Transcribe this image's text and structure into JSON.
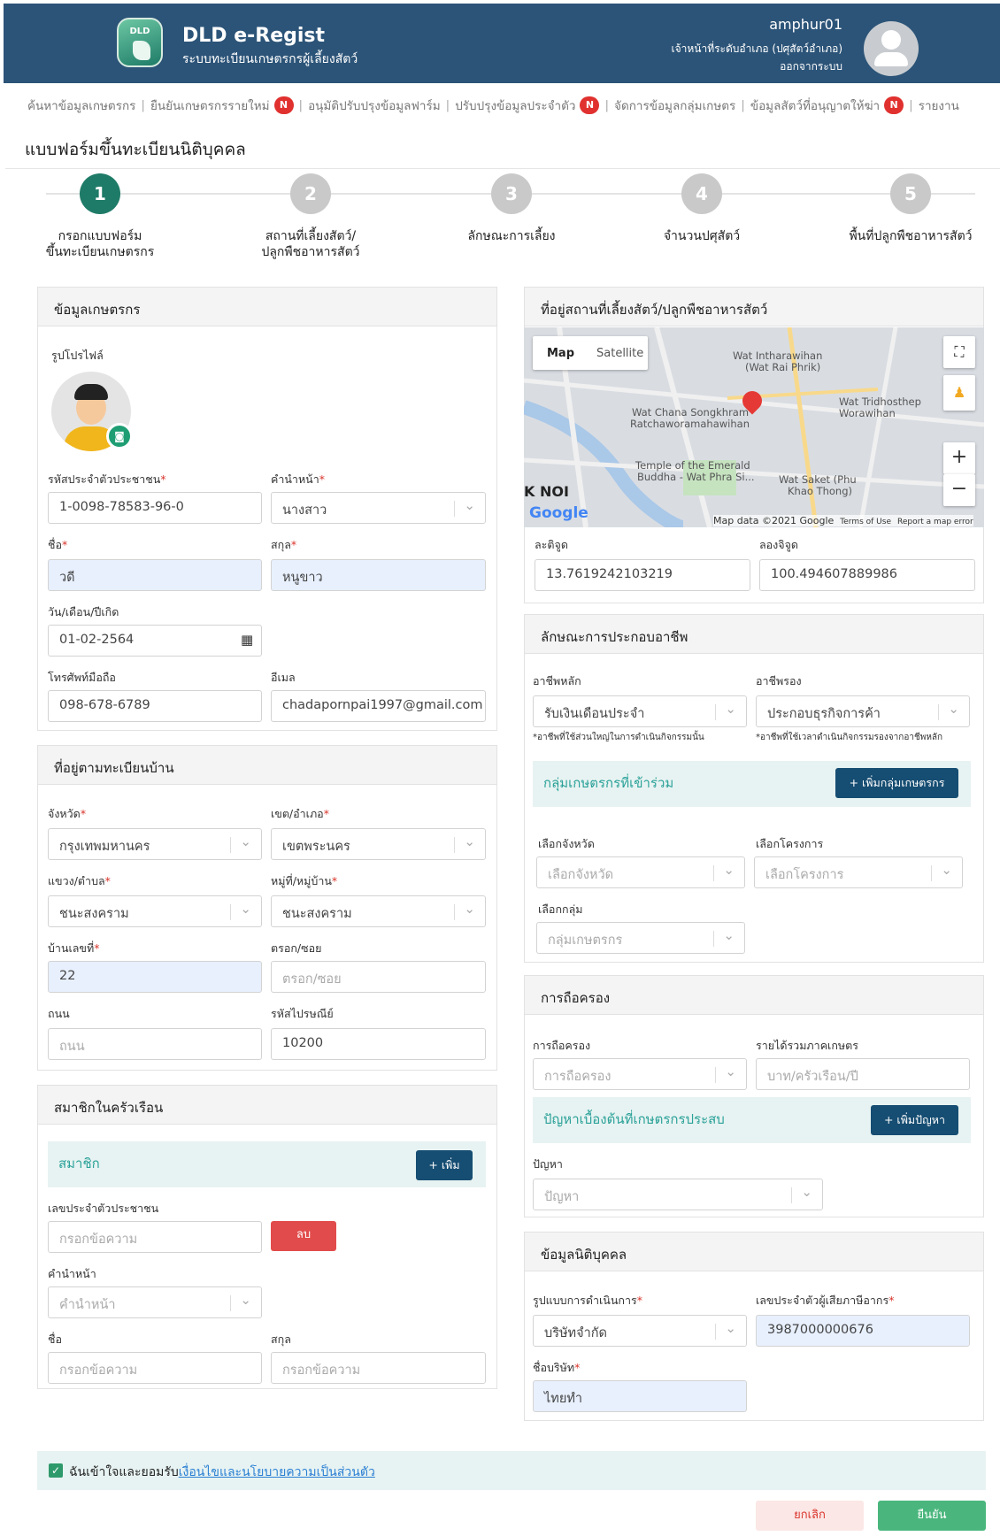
{
  "header": {
    "logo_text": "DLD",
    "title": "DLD e-Regist",
    "subtitle": "ระบบทะเบียนเกษตรกรผู้เลี้ยงสัตว์",
    "username": "amphur01",
    "role": "เจ้าหน้าที่ระดับอำเภอ (ปศุสัตว์อำเภอ)",
    "logout": "ออกจากระบบ"
  },
  "nav": [
    {
      "label": "ค้นหาข้อมูลเกษตรกร",
      "badge": ""
    },
    {
      "label": "ยืนยันเกษตรกรรายใหม่",
      "badge": "N"
    },
    {
      "label": "อนุมัติปรับปรุงข้อมูลฟาร์ม",
      "badge": ""
    },
    {
      "label": "ปรับปรุงข้อมูลประจำตัว",
      "badge": "N"
    },
    {
      "label": "จัดการข้อมูลกลุ่มเกษตร",
      "badge": ""
    },
    {
      "label": "ข้อมูลสัตว์ที่อนุญาตให้ฆ่า",
      "badge": "N"
    },
    {
      "label": "รายงาน",
      "badge": ""
    }
  ],
  "page_title": "แบบฟอร์มขึ้นทะเบียนนิติบุคคล",
  "steps": [
    {
      "num": "1",
      "line1": "กรอกแบบฟอร์ม",
      "line2": "ขึ้นทะเบียนเกษตรกร",
      "active": true
    },
    {
      "num": "2",
      "line1": "สถานที่เลี้ยงสัตว์/",
      "line2": "ปลูกพืชอาหารสัตว์",
      "active": false
    },
    {
      "num": "3",
      "line1": "ลักษณะการเลี้ยง",
      "line2": "",
      "active": false
    },
    {
      "num": "4",
      "line1": "จำนวนปศุสัตว์",
      "line2": "",
      "active": false
    },
    {
      "num": "5",
      "line1": "พื้นที่ปลูกพืชอาหารสัตว์",
      "line2": "",
      "active": false
    }
  ],
  "farmer": {
    "title": "ข้อมูลเกษตรกร",
    "profile_label": "รูปโปรไฟล์",
    "id_label": "รหัสประจำตัวประชาชน",
    "id_value": "1-0098-78583-96-0",
    "prefix_label": "คำนำหน้า",
    "prefix_value": "นางสาว",
    "first_label": "ชื่อ",
    "first_value": "วดี",
    "last_label": "สกุล",
    "last_value": "หนูขาว",
    "dob_label": "วัน/เดือน/ปีเกิด",
    "dob_value": "01-02-2564",
    "phone_label": "โทรศัพท์มือถือ",
    "phone_value": "098-678-6789",
    "email_label": "อีเมล",
    "email_value": "chadapornpai1997@gmail.com"
  },
  "address": {
    "title": "ที่อยู่ตามทะเบียนบ้าน",
    "province_label": "จังหวัด",
    "province_value": "กรุงเทพมหานคร",
    "district_label": "เขต/อำเภอ",
    "district_value": "เขตพระนคร",
    "subdistrict_label": "แขวง/ตำบล",
    "subdistrict_value": "ชนะสงคราม",
    "village_label": "หมู่ที่/หมู่บ้าน",
    "village_value": "ชนะสงคราม",
    "house_label": "บ้านเลขที่",
    "house_value": "22",
    "alley_label": "ตรอก/ซอย",
    "alley_placeholder": "ตรอก/ซอย",
    "road_label": "ถนน",
    "road_placeholder": "ถนน",
    "postal_label": "รหัสไปรษณีย์",
    "postal_value": "10200"
  },
  "household": {
    "title": "สมาชิกในครัวเรือน",
    "band": "สมาชิก",
    "add_button": "+ เพิ่ม",
    "id_label": "เลขประจำตัวประชาชน",
    "id_placeholder": "กรอกข้อความ",
    "delete_button": "ลบ",
    "prefix_label": "คำนำหน้า",
    "prefix_placeholder": "คำนำหน้า",
    "first_label": "ชื่อ",
    "first_placeholder": "กรอกข้อความ",
    "last_label": "สกุล",
    "last_placeholder": "กรอกข้อความ"
  },
  "location": {
    "title": "ที่อยู่สถานที่เลี้ยงสัตว์/ปลูกพืชอาหารสัตว์",
    "map_tab": "Map",
    "satellite_tab": "Satellite",
    "places": [
      "Wat Intharawihan",
      "(Wat Rai Phrik)",
      "Wat Tridhosthep",
      "Worawihan",
      "Wat Chana Songkhram",
      "Ratchaworamahawihan",
      "Temple of the Emerald",
      "Buddha - Wat Phra Si...",
      "Wat Saket (Phu",
      "Khao Thong)",
      "K NOI"
    ],
    "google": "Google",
    "map_data": "Map data ©2021 Google",
    "terms": "Terms of Use",
    "report": "Report a map error",
    "lat_label": "ละติจูด",
    "lat_value": "13.7619242103219",
    "lng_label": "ลองจิจูด",
    "lng_value": "100.494607889986"
  },
  "career": {
    "title": "ลักษณะการประกอบอาชีพ",
    "main_label": "อาชีพหลัก",
    "main_value": "รับเงินเดือนประจำ",
    "main_hint": "*อาชีพที่ใช้ส่วนใหญ่ในการดำเนินกิจกรรมนั้น",
    "secondary_label": "อาชีพรอง",
    "secondary_value": "ประกอบธุรกิจการค้า",
    "secondary_hint": "*อาชีพที่ใช้เวลาดำเนินกิจกรรมรองจากอาชีพหลัก",
    "group_band": "กลุ่มเกษตรกรที่เข้าร่วม",
    "group_button": "+ เพิ่มกลุ่มเกษตรกร",
    "province_label": "เลือกจังหวัด",
    "province_placeholder": "เลือกจังหวัด",
    "project_label": "เลือกโครงการ",
    "project_placeholder": "เลือกโครงการ",
    "group_label": "เลือกกลุ่ม",
    "group_placeholder": "กลุ่มเกษตรกร"
  },
  "holding": {
    "title": "การถือครอง",
    "holding_label": "การถือครอง",
    "holding_placeholder": "การถือครอง",
    "income_label": "รายได้รวมภาคเกษตร",
    "income_placeholder": "บาท/ครัวเรือน/ปี",
    "problem_band": "ปัญหาเบื้องต้นที่เกษตรกรประสบ",
    "problem_button": "+ เพิ่มปัญหา",
    "problem_label": "ปัญหา",
    "problem_placeholder": "ปัญหา"
  },
  "juristic": {
    "title": "ข้อมูลนิติบุคคล",
    "type_label": "รูปแบบการดำเนินการ",
    "type_value": "บริษัทจำกัด",
    "tax_label": "เลขประจำตัวผู้เสียภาษีอากร",
    "tax_value": "3987000000676",
    "company_label": "ชื่อบริษัท",
    "company_value": "ไทยทำ"
  },
  "consent": {
    "text": "ฉันเข้าใจและยอมรับ",
    "link": "เงื่อนไขและนโยบายความเป็นส่วนตัว",
    "checked": true
  },
  "actions": {
    "cancel": "ยกเลิก",
    "confirm": "ยืนยัน"
  },
  "colors": {
    "header": "#2c5478",
    "accent": "#1e7b67",
    "button": "#164d72",
    "badge": "#e0312f",
    "band": "#e7f3f2",
    "confirm": "#4ab67d"
  }
}
